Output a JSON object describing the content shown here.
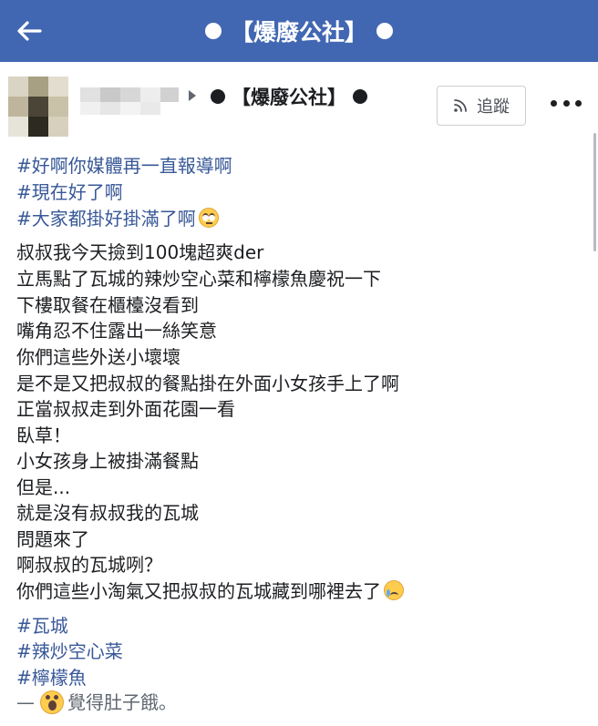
{
  "topbar": {
    "title": "【爆廢公社】",
    "color": "#4267b2"
  },
  "post": {
    "page_name": "【爆廢公社】",
    "follow_label": "追蹤",
    "hashtags_top": [
      "#好啊你媒體再一直報導啊",
      "#現在好了啊",
      "#大家都掛好掛滿了啊"
    ],
    "body_lines": [
      "叔叔我今天撿到100塊超爽der",
      "立馬點了瓦城的辣炒空心菜和檸檬魚慶祝一下",
      "下樓取餐在櫃檯沒看到",
      "嘴角忍不住露出一絲笑意",
      "你們這些外送小壞壞",
      "是不是又把叔叔的餐點掛在外面小女孩手上了啊",
      "正當叔叔走到外面花園一看",
      "臥草！",
      "小女孩身上被掛滿餐點",
      "但是...",
      "就是沒有叔叔我的瓦城",
      "問題來了",
      "啊叔叔的瓦城咧？",
      "你們這些小淘氣又把叔叔的瓦城藏到哪裡去了"
    ],
    "hashtags_bottom": [
      "#瓦城",
      "#辣炒空心菜",
      "#檸檬魚"
    ],
    "feeling_prefix": "—",
    "feeling_text": "覺得肚子餓。",
    "icons": {
      "back": "back-arrow-icon",
      "rss": "rss-icon",
      "more": "more-horizontal-icon",
      "caret": "caret-right-icon",
      "emoji_eyeroll": "eye-roll-emoji-icon",
      "emoji_cry": "crying-emoji-icon",
      "emoji_shock": "shocked-emoji-icon"
    },
    "link_color": "#385898"
  }
}
